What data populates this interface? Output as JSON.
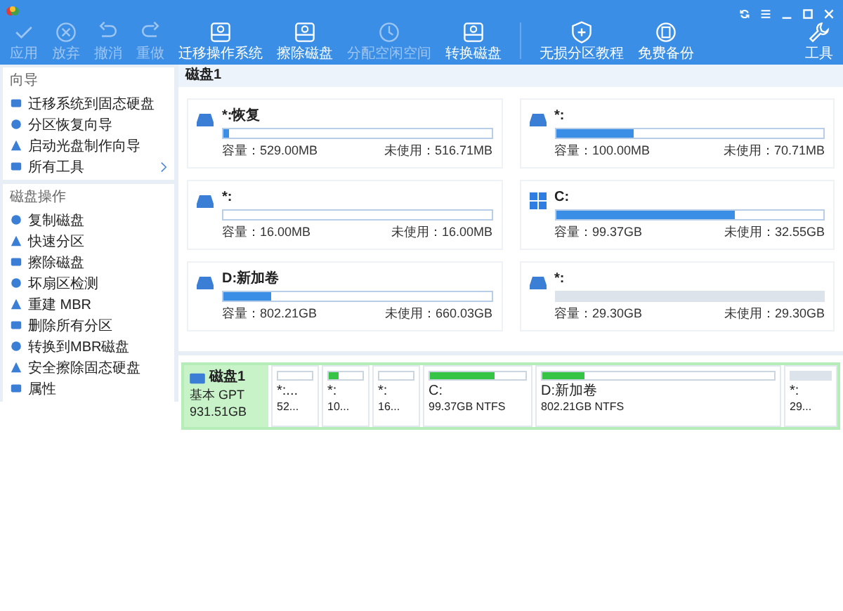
{
  "toolbar": [
    {
      "label": "应用",
      "disabled": true
    },
    {
      "label": "放弃",
      "disabled": true
    },
    {
      "label": "撤消",
      "disabled": true
    },
    {
      "label": "重做",
      "disabled": true
    },
    {
      "label": "迁移操作系统",
      "disabled": false
    },
    {
      "label": "擦除磁盘",
      "disabled": false
    },
    {
      "label": "分配空闲空间",
      "disabled": true
    },
    {
      "label": "转换磁盘",
      "disabled": false
    },
    {
      "label": "无损分区教程",
      "disabled": false
    },
    {
      "label": "免费备份",
      "disabled": false
    }
  ],
  "tools_button": {
    "label": "工具"
  },
  "sidebar": [
    {
      "title": "向导",
      "items": [
        {
          "label": "迁移系统到固态硬盘",
          "submenu": false
        },
        {
          "label": "分区恢复向导",
          "submenu": false
        },
        {
          "label": "启动光盘制作向导",
          "submenu": false
        },
        {
          "label": "所有工具",
          "submenu": true
        }
      ]
    },
    {
      "title": "磁盘操作",
      "items": [
        {
          "label": "复制磁盘",
          "submenu": false
        },
        {
          "label": "快速分区",
          "submenu": false
        },
        {
          "label": "擦除磁盘",
          "submenu": false
        },
        {
          "label": "坏扇区检测",
          "submenu": false
        },
        {
          "label": "重建 MBR",
          "submenu": false
        },
        {
          "label": "删除所有分区",
          "submenu": false
        },
        {
          "label": "转换到MBR磁盘",
          "submenu": false
        },
        {
          "label": "安全擦除固态硬盘",
          "submenu": false
        },
        {
          "label": "属性",
          "submenu": false
        }
      ]
    }
  ],
  "disk_title": "磁盘1",
  "partitions": [
    {
      "kind": "partition",
      "name": "*:恢复",
      "capacity": "容量：529.00MB",
      "free": "未使用：516.71MB",
      "level": 0.02
    },
    {
      "kind": "partition",
      "name": "*:",
      "capacity": "容量：100.00MB",
      "free": "未使用：70.71MB",
      "level": 0.29
    },
    {
      "kind": "partition",
      "name": "*:",
      "capacity": "容量：16.00MB",
      "free": "未使用：16.00MB",
      "level": 0
    },
    {
      "kind": "system",
      "name": "C:",
      "capacity": "容量：99.37GB",
      "free": "未使用：32.55GB",
      "level": 0.67
    },
    {
      "kind": "partition",
      "name": "D:新加卷",
      "capacity": "容量：802.21GB",
      "free": "未使用：660.03GB",
      "level": 0.18
    },
    {
      "kind": "unallocated",
      "name": "*:",
      "capacity": "容量：29.30GB",
      "free": "未使用：29.30GB",
      "level": 0
    }
  ],
  "disk_map": {
    "name": "磁盘1",
    "type": "基本 GPT",
    "size": "931.51GB",
    "segments": [
      {
        "kind": "partition",
        "name": "*:...",
        "size": "52...",
        "level": 0
      },
      {
        "kind": "partition",
        "name": "*:",
        "size": "10...",
        "level": 0.3
      },
      {
        "kind": "partition",
        "name": "*:",
        "size": "16...",
        "level": 0
      },
      {
        "kind": "partition",
        "name": "C:",
        "size": "99.37GB NTFS",
        "level": 0.67
      },
      {
        "kind": "partition",
        "name": "D:新加卷",
        "size": "802.21GB NTFS",
        "level": 0.18
      },
      {
        "kind": "unallocated",
        "name": "*:",
        "size": "29...",
        "level": 0
      }
    ]
  }
}
